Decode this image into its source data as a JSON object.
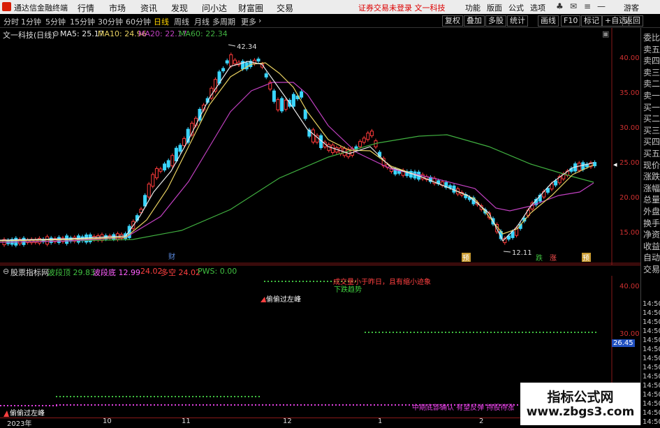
{
  "titlebar": {
    "app_name": "通达信金融终端",
    "menus": [
      "行情",
      "市场",
      "资讯",
      "发现",
      "问小达",
      "财富圈",
      "交易"
    ],
    "warning": "证券交易未登录  文一科技",
    "right_menus": [
      "功能",
      "版面",
      "公式",
      "选项"
    ],
    "guest": "游客"
  },
  "periods": [
    "分时",
    "1分钟",
    "5分钟",
    "15分钟",
    "30分钟",
    "60分钟",
    "日线",
    "周线",
    "月线",
    "多周期",
    "更多"
  ],
  "active_period": "日线",
  "toolbar": [
    "复权",
    "叠加",
    "多股",
    "统计",
    "画线",
    "F10",
    "标记",
    "+自选",
    "返回"
  ],
  "main_chart": {
    "security": "文一科技(日线)",
    "ma": [
      {
        "label": "MA5: 25.17",
        "color": "#e8e8e8"
      },
      {
        "label": "MA10: 24.96",
        "color": "#e8d060"
      },
      {
        "label": "MA20: 22.17",
        "color": "#c040c0"
      },
      {
        "label": "MA60: 22.34",
        "color": "#40b040"
      }
    ],
    "y_ticks": [
      "40.00",
      "35.00",
      "30.00",
      "25.00",
      "20.00",
      "15.00"
    ],
    "high_label": "42.34",
    "low_label": "12.11",
    "markers": [
      "财",
      "预",
      "跌",
      "涨",
      "预"
    ]
  },
  "indicator": {
    "name": "股票指标网",
    "values": [
      {
        "label": "波段顶 29.83",
        "color": "#40c040"
      },
      {
        "label": "波段底 12.99",
        "color": "#ff60ff"
      },
      {
        "label": "24.02",
        "color": "#ff4040"
      },
      {
        "label": "多空 24.02",
        "color": "#ff4040"
      },
      {
        "label": "PWS: 0.00",
        "color": "#40c040"
      }
    ],
    "y_ticks": [
      "40.00",
      "30.00"
    ],
    "current_value": "26.45",
    "annotations": {
      "top_red": "成交量小于昨日，且有缩小迹象",
      "down_trend": "下跌趋势",
      "left_peak": "偷偷过左峰",
      "left_peak_bottom": "偷偷过左峰",
      "bottom_magenta": "中期底部确认 有望反弹 持股待涨"
    }
  },
  "right_panel": {
    "labels": [
      "委比",
      "卖五",
      "卖四",
      "卖三",
      "卖二",
      "卖一",
      "买一",
      "买二",
      "买三",
      "买四",
      "买五",
      "现价",
      "涨跌",
      "涨幅",
      "总量",
      "外盘",
      "换手",
      "净资",
      "收益",
      "自动",
      "交易"
    ],
    "times": [
      "14:50",
      "14:50",
      "14:50",
      "14:50",
      "14:50",
      "14:50",
      "14:50",
      "14:50",
      "14:50",
      "14:50",
      "14:50",
      "14:50",
      "14:50",
      "14:50"
    ]
  },
  "x_axis": [
    "2023年",
    "10",
    "11",
    "12",
    "1",
    "2"
  ],
  "watermark": {
    "line1": "指标公式网",
    "line2": "www.zbgs3.com"
  }
}
